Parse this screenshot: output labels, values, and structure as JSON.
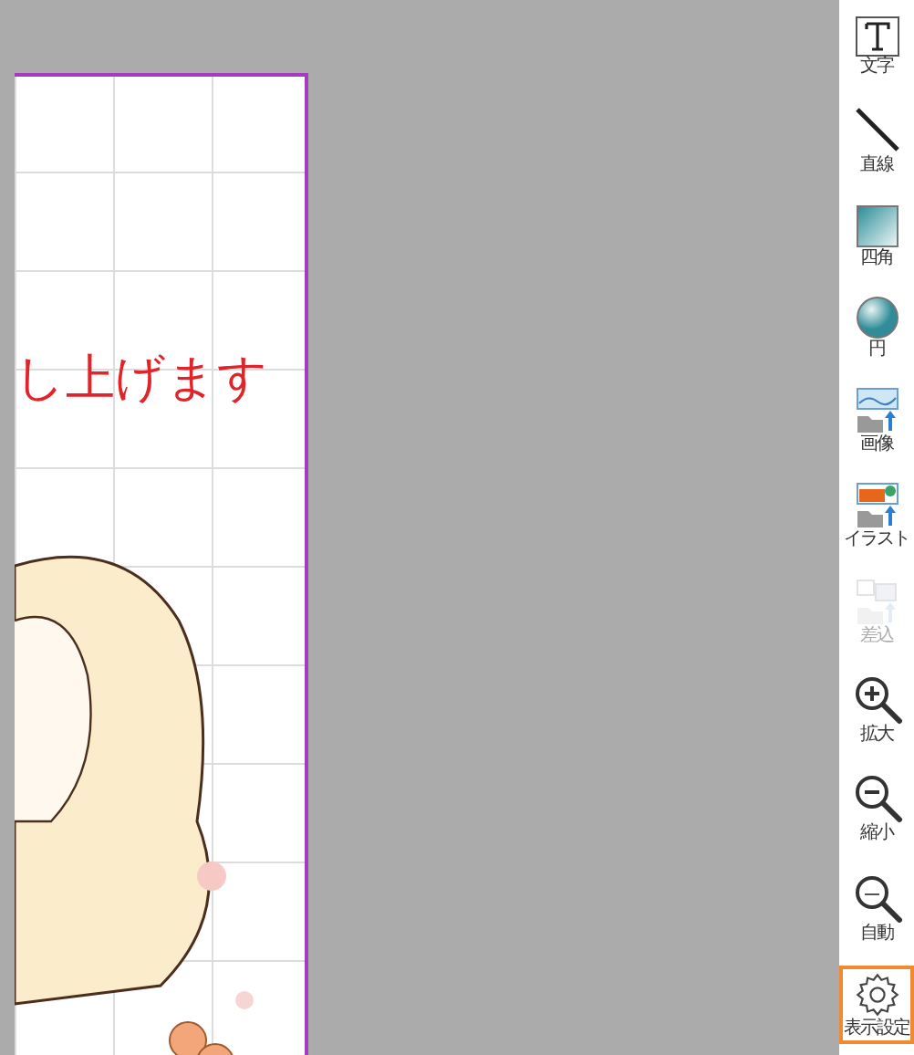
{
  "canvas": {
    "text": "し上げます"
  },
  "toolbar": [
    {
      "kind": "text",
      "label": "文字",
      "selected": false,
      "disabled": false
    },
    {
      "kind": "line",
      "label": "直線",
      "selected": false,
      "disabled": false
    },
    {
      "kind": "rect",
      "label": "四角",
      "selected": false,
      "disabled": false
    },
    {
      "kind": "circle",
      "label": "円",
      "selected": false,
      "disabled": false
    },
    {
      "kind": "image",
      "label": "画像",
      "selected": false,
      "disabled": false
    },
    {
      "kind": "illust",
      "label": "イラスト",
      "selected": false,
      "disabled": false
    },
    {
      "kind": "insert",
      "label": "差込",
      "selected": false,
      "disabled": true
    },
    {
      "kind": "zoomin",
      "label": "拡大",
      "selected": false,
      "disabled": false
    },
    {
      "kind": "zoomout",
      "label": "縮小",
      "selected": false,
      "disabled": false
    },
    {
      "kind": "zoomauto",
      "label": "自動",
      "selected": false,
      "disabled": false
    },
    {
      "kind": "settings",
      "label": "表示設定",
      "selected": true,
      "disabled": false
    }
  ]
}
